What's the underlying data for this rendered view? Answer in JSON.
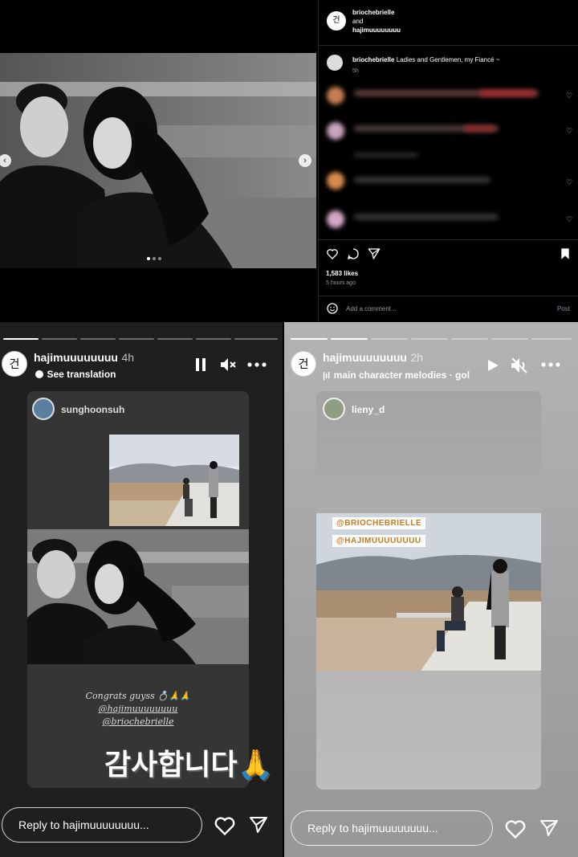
{
  "post": {
    "author": "briochebrielle",
    "and": "and",
    "coauthor": "hajimuuuuuuuu",
    "caption": "Ladies and Gentlemen, my Fiancé ~",
    "caption_time": "5h",
    "likes": "1,583 likes",
    "posted": "5 hours ago",
    "comment_placeholder": "Add a comment...",
    "post_label": "Post"
  },
  "storyLeft": {
    "username": "hajimuuuuuuuu",
    "time": "4h",
    "subtitle": "See translation",
    "shared_from": "sunghoonsuh",
    "caption_lines": [
      "Congrats guyss 💍🙏🙏",
      "@hajimuuuuuuuu",
      "@briochebrielle"
    ],
    "sticker_text": "감사합니다🙏",
    "reply_placeholder": "Reply to hajimuuuuuuuu..."
  },
  "storyRight": {
    "username": "hajimuuuuuuuu",
    "time": "2h",
    "music": "main character melodies · gol",
    "shared_from": "lieny_d",
    "tags": [
      "@BRIOCHEBRIELLE",
      "@HAJIMUUUUUUUU"
    ],
    "reply_placeholder": "Reply to hajimuuuuuuuu..."
  },
  "logo_text": "건",
  "icons": {
    "pause": "pause-icon",
    "mute": "mute-icon",
    "more": "more-icon",
    "heart": "heart-icon",
    "send": "send-icon",
    "play": "play-icon",
    "comment": "comment-icon",
    "save": "save-icon",
    "emoji": "emoji-icon"
  },
  "colors": {
    "story_left_bg": "#1f1f1f",
    "story_right_bg": "#a9a9a9",
    "tag_bg": "#ffffff",
    "tag_text": "#c8791e"
  }
}
